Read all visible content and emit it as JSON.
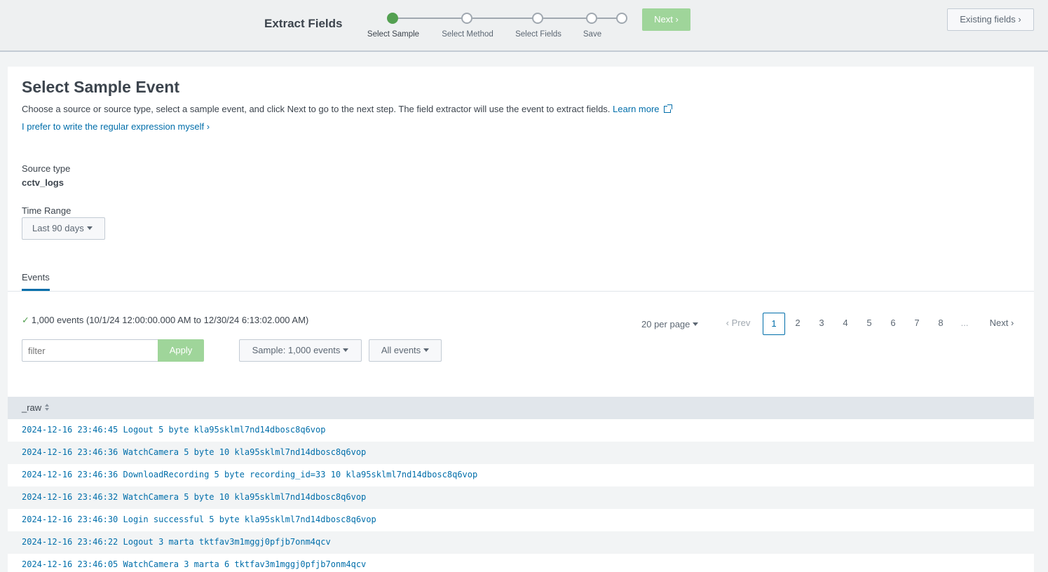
{
  "header": {
    "title": "Extract Fields",
    "steps": [
      {
        "label": "Select Sample",
        "active": true
      },
      {
        "label": "Select Method",
        "active": false
      },
      {
        "label": "Select Fields",
        "active": false
      },
      {
        "label": "Save",
        "active": false
      }
    ],
    "next_label": "Next",
    "existing_fields_label": "Existing fields"
  },
  "main": {
    "title": "Select Sample Event",
    "description": "Choose a source or source type, select a sample event, and click Next to go to the next step. The field extractor will use the event to extract fields.",
    "learn_more": "Learn more",
    "regex_link": "I prefer to write the regular expression myself",
    "source_type_label": "Source type",
    "source_type_value": "cctv_logs",
    "time_range_label": "Time Range",
    "time_range_value": "Last 90 days",
    "tab_label": "Events",
    "event_count": "1,000 events (10/1/24 12:00:00.000 AM to 12/30/24 6:13:02.000 AM)",
    "filter_placeholder": "filter",
    "apply_label": "Apply",
    "sample_label": "Sample: 1,000 events",
    "all_events_label": "All events"
  },
  "pagination": {
    "per_page": "20 per page",
    "prev": "Prev",
    "pages": [
      "1",
      "2",
      "3",
      "4",
      "5",
      "6",
      "7",
      "8"
    ],
    "ellipsis": "...",
    "next": "Next",
    "current": "1"
  },
  "table": {
    "column": "_raw",
    "rows": [
      "2024-12-16 23:46:45 Logout 5 byte kla95sklml7nd14dbosc8q6vop",
      "2024-12-16 23:46:36 WatchCamera 5 byte 10 kla95sklml7nd14dbosc8q6vop",
      "2024-12-16 23:46:36 DownloadRecording 5 byte recording_id=33 10 kla95sklml7nd14dbosc8q6vop",
      "2024-12-16 23:46:32 WatchCamera 5 byte 10 kla95sklml7nd14dbosc8q6vop",
      "2024-12-16 23:46:30 Login successful 5 byte kla95sklml7nd14dbosc8q6vop",
      "2024-12-16 23:46:22 Logout 3 marta tktfav3m1mggj0pfjb7onm4qcv",
      "2024-12-16 23:46:05 WatchCamera 3 marta 6 tktfav3m1mggj0pfjb7onm4qcv"
    ]
  },
  "colors": {
    "accent": "#006eaa",
    "success": "#53a051",
    "disabled_green": "#9fd59a"
  }
}
